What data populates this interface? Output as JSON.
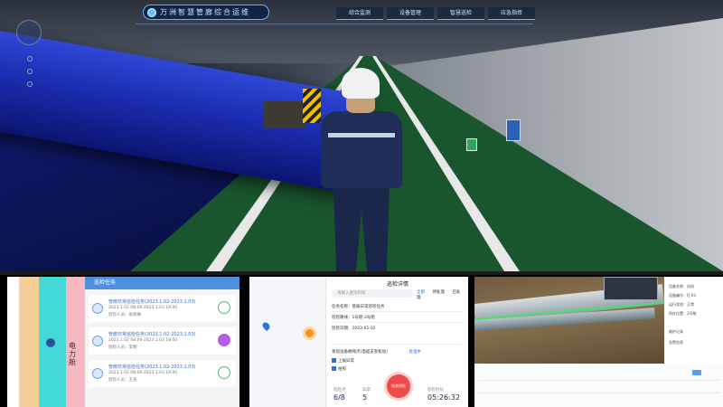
{
  "scene": {
    "hud_title": "万洲智慧管廊综合运维",
    "nav": [
      "综合监测",
      "设备管理",
      "智慧巡检",
      "应急指挥"
    ]
  },
  "panel1": {
    "header": "巡检任务",
    "vertical_label": "电力舱",
    "items": [
      {
        "title": "管廊日常巡检任务(2023.1.02-2023.1.03)",
        "sub": "2023.1.02 08:00-2023.1.03 18:00",
        "sub2": "巡检人员：张晓琳"
      },
      {
        "title": "管廊日常巡检任务(2023.1.02-2023.1.03)",
        "sub": "2023.1.02 08:00-2023.1.03 18:00",
        "sub2": "巡检人员：李明"
      },
      {
        "title": "管廊日常巡检任务(2023.1.02-2023.1.03)",
        "sub": "2023.1.02 08:00-2023.1.03 18:00",
        "sub2": "巡检人员：王浩"
      }
    ]
  },
  "panel2": {
    "title": "巡检详情",
    "search_placeholder": "请输入查询内容",
    "tabs": [
      "全部",
      "待处理",
      "已处理"
    ],
    "row1": "任务名称：管廊日常巡检任务",
    "row2": "巡检路线：1号舱-3号舱",
    "row3": "巡检日期：2023-01-02",
    "issue": "发现设备故障点(电缆支架松动)",
    "issue_tag": "处理中",
    "opt1": "上报异常",
    "opt2": "拍照",
    "submit": "结束巡检",
    "stats": [
      {
        "label": "巡检点",
        "value": "6/8"
      },
      {
        "label": "异常",
        "value": "5"
      },
      {
        "label": "巡检时长",
        "value": "05:26:32"
      }
    ]
  },
  "panel3": {
    "side_lines": [
      "设备名称：风机",
      "设备编号：FJ-03",
      "运行状态：正常",
      "所在位置：2号舱",
      "维护记录",
      "告警信息"
    ]
  }
}
